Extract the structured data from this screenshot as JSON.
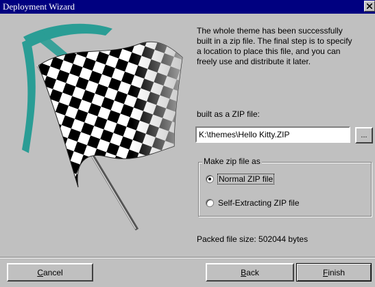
{
  "window": {
    "title": "Deployment Wizard",
    "close_glyph": "✕"
  },
  "description": "The whole theme has been successfully built in a zip file. The final step is to specify a location to place this file, and you can freely use and distribute it later.",
  "zip": {
    "label": "built as a ZIP file:",
    "path_value": "K:\\themes\\Hello Kitty.ZIP",
    "browse_label": "..."
  },
  "zip_type": {
    "legend": "Make zip file as",
    "options": [
      {
        "label": "Normal ZIP file",
        "selected": true
      },
      {
        "label": "Self-Extracting ZIP file",
        "selected": false
      }
    ]
  },
  "packed_size": "Packed file size: 502044 bytes",
  "buttons": {
    "cancel": {
      "mnemonic": "C",
      "rest": "ancel"
    },
    "back": {
      "mnemonic": "B",
      "rest": "ack"
    },
    "finish": {
      "mnemonic": "F",
      "rest": "inish"
    }
  },
  "colors": {
    "titlebar": "#000080",
    "face": "#c0c0c0",
    "teal": "#2a9d95"
  },
  "icons": [
    "close-icon",
    "checkered-flag-illustration"
  ]
}
